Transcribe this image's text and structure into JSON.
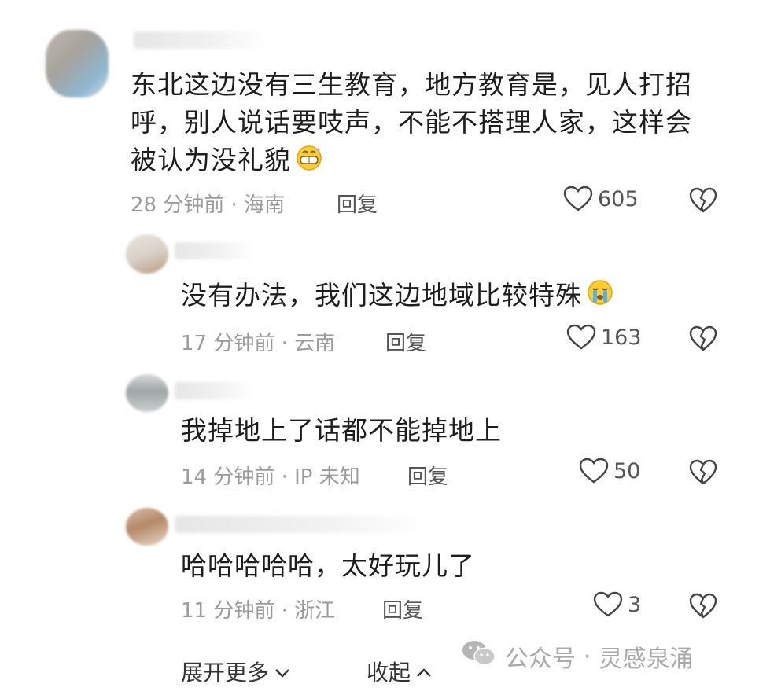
{
  "comments": [
    {
      "text": "东北这边没有三生教育，地方教育是，见人打招呼，别人说话要吱声，不能不搭理人家，这样会被认为没礼貌",
      "emoji": "grin-sweat-emoji",
      "time_location": "28 分钟前 · 海南",
      "reply_label": "回复",
      "likes": "605"
    },
    {
      "text": "没有办法，我们这边地域比较特殊",
      "emoji": "crying-emoji",
      "time_location": "17 分钟前 · 云南",
      "reply_label": "回复",
      "likes": "163"
    },
    {
      "text": "我掉地上了话都不能掉地上",
      "time_location": "14 分钟前 · IP 未知",
      "reply_label": "回复",
      "likes": "50"
    },
    {
      "text": "哈哈哈哈哈，太好玩儿了",
      "time_location": "11 分钟前 · 浙江",
      "reply_label": "回复",
      "likes": "3"
    }
  ],
  "footer": {
    "expand_label": "展开更多",
    "collapse_label": "收起"
  },
  "watermark": {
    "prefix": "公众号",
    "separator": "·",
    "name": "灵感泉涌"
  },
  "colors": {
    "meta_gray": "#9b9b9b",
    "text": "#1d1d1d",
    "icon": "#555555"
  }
}
